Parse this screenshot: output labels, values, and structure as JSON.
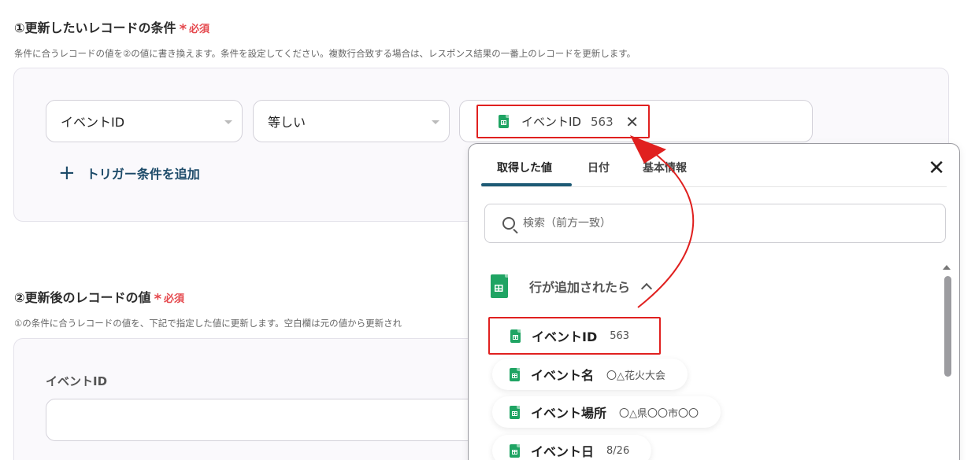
{
  "section1": {
    "title": "①更新したいレコードの条件",
    "required": "必須",
    "description": "条件に合うレコードの値を②の値に書き換えます。条件を設定してください。複数行合致する場合は、レスポンス結果の一番上のレコードを更新します。",
    "field_select": "イベントID",
    "operator_select": "等しい",
    "chip_label": "イベントID",
    "chip_value": "563",
    "add_trigger_label": "トリガー条件を追加"
  },
  "section2": {
    "title": "②更新後のレコードの値",
    "required": "必須",
    "description": "①の条件に合うレコードの値を、下記で指定した値に更新します。空白欄は元の値から更新され",
    "field_label": "イベントID"
  },
  "popup": {
    "tabs": [
      "取得した値",
      "日付",
      "基本情報"
    ],
    "active_tab": "取得した値",
    "search_placeholder": "検索（前方一致）",
    "group_label": "行が追加されたら",
    "items": [
      {
        "name": "イベントID",
        "value": "563"
      },
      {
        "name": "イベント名",
        "value": "〇△花火大会"
      },
      {
        "name": "イベント場所",
        "value": "〇△県〇〇市〇〇"
      },
      {
        "name": "イベント日",
        "value": "8/26"
      }
    ]
  },
  "colors": {
    "accent": "#1d5a75",
    "required": "#e5484d",
    "highlight": "#e0201f",
    "sheet_green": "#1fa463"
  },
  "icons": [
    "spreadsheet-icon",
    "close-icon",
    "search-icon",
    "chevron-up-icon",
    "plus-icon"
  ]
}
